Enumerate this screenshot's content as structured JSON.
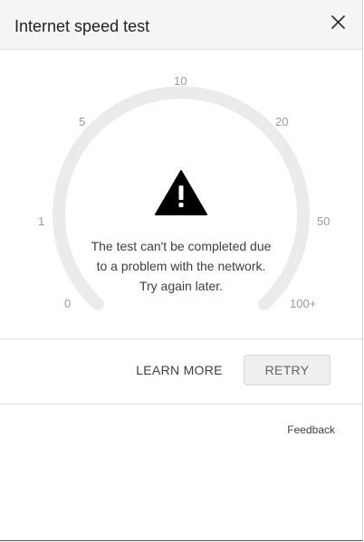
{
  "dialog": {
    "title": "Internet speed test"
  },
  "gauge": {
    "ticks": [
      "0",
      "1",
      "5",
      "10",
      "20",
      "50",
      "100+"
    ],
    "track_color": "#ebebeb",
    "warning_icon": "warning-triangle-icon",
    "message": "The test can't be completed due to a problem with the network. Try again later."
  },
  "actions": {
    "learn_more_label": "LEARN MORE",
    "retry_label": "RETRY"
  },
  "footer": {
    "feedback_label": "Feedback"
  }
}
